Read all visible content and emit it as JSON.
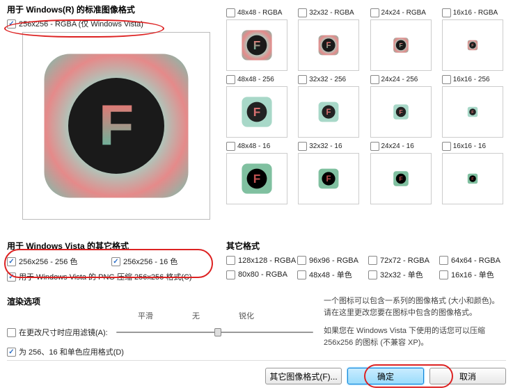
{
  "sections": {
    "std_title": "用于 Windows(R) 的标准图像格式",
    "vista_title": "用于 Windows Vista 的其它格式",
    "other_title": "其它格式",
    "render_title": "渲染选项"
  },
  "std_checkbox": "256x256 - RGBA (仅 Windows Vista)",
  "grid": {
    "r1": [
      "48x48 - RGBA",
      "32x32 - RGBA",
      "24x24 - RGBA",
      "16x16 - RGBA"
    ],
    "r2": [
      "48x48 - 256",
      "32x32 - 256",
      "24x24 - 256",
      "16x16 - 256"
    ],
    "r3": [
      "48x48 - 16",
      "32x32 - 16",
      "24x24 - 16",
      "16x16 - 16"
    ]
  },
  "vista": {
    "a": "256x256 - 256 色",
    "b": "256x256 - 16 色",
    "c": "用于 Windows Vista 的 PNG 压缩 256x256 格式(C)"
  },
  "other": [
    "128x128 - RGBA",
    "96x96 - RGBA",
    "72x72 - RGBA",
    "64x64 - RGBA",
    "80x80 - RGBA",
    "48x48 - 单色",
    "32x32 - 单色",
    "16x16 - 单色"
  ],
  "slider": {
    "left": "平滑",
    "mid": "无",
    "right": "锐化"
  },
  "render": {
    "a": "在更改尺寸时应用滤镜(A):",
    "b": "为 256、16 和单色应用格式(D)"
  },
  "help": {
    "p1": "一个图标可以包含一系列的图像格式 (大小和颜色)。请在这里更改您要在图标中包含的图像格式。",
    "p2": "如果您在 Windows Vista 下使用的话您可以压缩 256x256 的图标 (不兼容 XP)。"
  },
  "buttons": {
    "other": "其它图像格式(F)...",
    "ok": "确定",
    "cancel": "取消"
  }
}
